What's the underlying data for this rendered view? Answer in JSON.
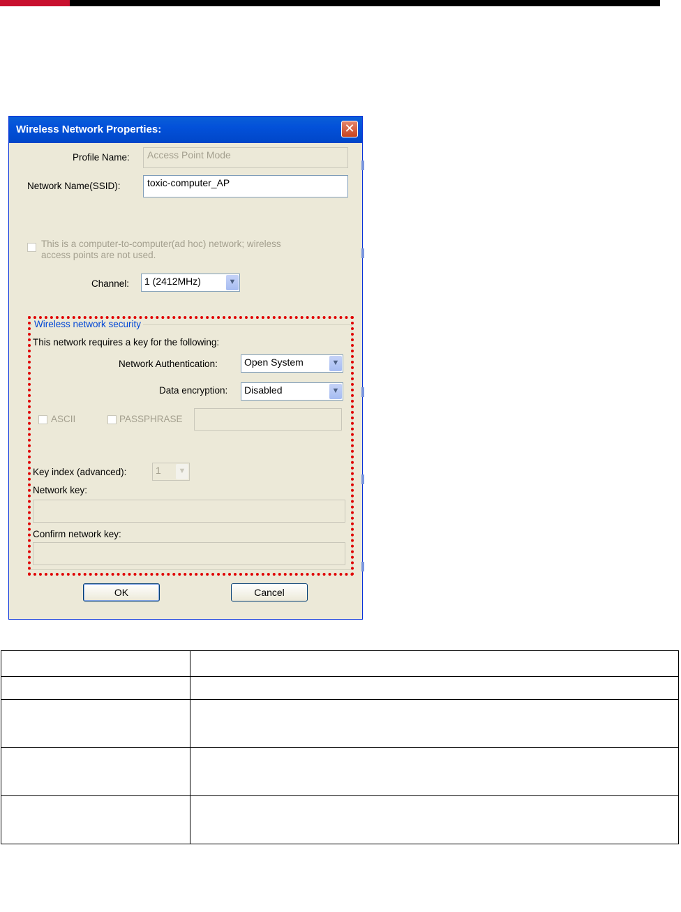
{
  "window": {
    "title": "Wireless Network Properties:",
    "close_glyph": "✕",
    "profile_name_label": "Profile Name:",
    "profile_name_value": "Access Point Mode",
    "ssid_label": "Network Name(SSID):",
    "ssid_value": "toxic-computer_AP",
    "adhoc_label_line1": "This is a computer-to-computer(ad hoc) network; wireless",
    "adhoc_label_line2": "access points are not used.",
    "channel_label": "Channel:",
    "channel_value": "1  (2412MHz)",
    "security_group_label": "Wireless network security",
    "security_intro": "This network requires a key for the following:",
    "auth_label": "Network Authentication:",
    "auth_value": "Open System",
    "encryption_label": "Data encryption:",
    "encryption_value": "Disabled",
    "ascii_label": "ASCII",
    "passphrase_label": "PASSPHRASE",
    "key_index_label": "Key index (advanced):",
    "key_index_value": "1",
    "network_key_label": "Network key:",
    "confirm_key_label": "Confirm network key:",
    "ok_label": "OK",
    "cancel_label": "Cancel"
  },
  "colors": {
    "accent_red": "#c8102e",
    "titlebar_blue": "#0351d9",
    "dotted_highlight": "#e00000"
  }
}
